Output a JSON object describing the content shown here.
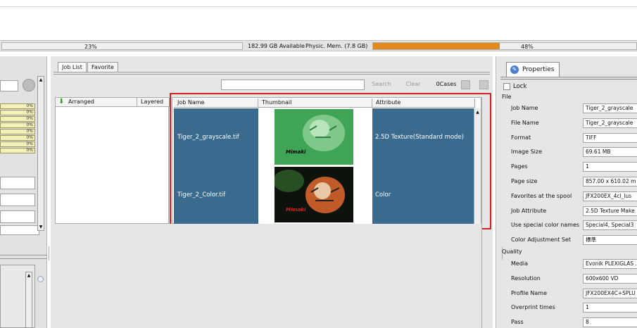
{
  "status_bar": {
    "disk_percent": "23%",
    "disk_available": "182.99 GB Available",
    "memory_label": "Physic. Mem. (7.8 GB)",
    "memory_percent": "48%",
    "memory_fill": 0.48,
    "memory_color": "#e08a1e"
  },
  "left_panel": {
    "percent_rows": [
      "0%",
      "0%",
      "0%",
      "0%",
      "0%",
      "0%",
      "0%",
      "0%"
    ]
  },
  "job_tabs": [
    "Job List",
    "Favorite"
  ],
  "toolbar": {
    "search_label": "Search",
    "clear_label": "Clear",
    "case_count": "0Cases"
  },
  "arrange_headers": {
    "arranged": "Arranged",
    "layered": "Layered"
  },
  "job_table": {
    "headers": [
      "Job Name",
      "Thumbnail",
      "Attribute"
    ],
    "rows": [
      {
        "name": "Tiger_2_grayscale.tif",
        "attribute": "2.5D Texture(Standard mode)",
        "thumb_logo": "Mimaki"
      },
      {
        "name": "Tiger_2_Color.tif",
        "attribute": "Color",
        "thumb_logo": "Mimaki"
      }
    ],
    "row_color": "#3b6a8f",
    "highlight_color": "#d42020"
  },
  "properties": {
    "tab_label": "Properties",
    "lock_label": "Lock",
    "file_section": "File",
    "file_rows": [
      {
        "label": "Job Name",
        "value": "Tiger_2_grayscale"
      },
      {
        "label": "File Name",
        "value": "Tiger_2_grayscale"
      },
      {
        "label": "Format",
        "value": "TIFF"
      },
      {
        "label": "Image Size",
        "value": "69.61 MB"
      },
      {
        "label": "Pages",
        "value": "1"
      },
      {
        "label": "Page size",
        "value": "857.00 x 610.02 m"
      },
      {
        "label": "Favorites at the spool",
        "value": "JFX200EX_4cl_lus"
      },
      {
        "label": "Job Attribute",
        "value": "2.5D Texture Make"
      },
      {
        "label": "Use special color names",
        "value": "Special4, Special3"
      },
      {
        "label": "Color Adjustment Set",
        "value": "標準"
      }
    ],
    "quality_section": "Quality",
    "quality_rows": [
      {
        "label": "Media",
        "value": "Evonik PLEXIGLAS ."
      },
      {
        "label": "Resolution",
        "value": "600x600 VD"
      },
      {
        "label": "Profile Name",
        "value": "JFX200EX4C+SPLU"
      },
      {
        "label": "Overprint times",
        "value": "1"
      },
      {
        "label": "Pass",
        "value": "8"
      }
    ]
  }
}
